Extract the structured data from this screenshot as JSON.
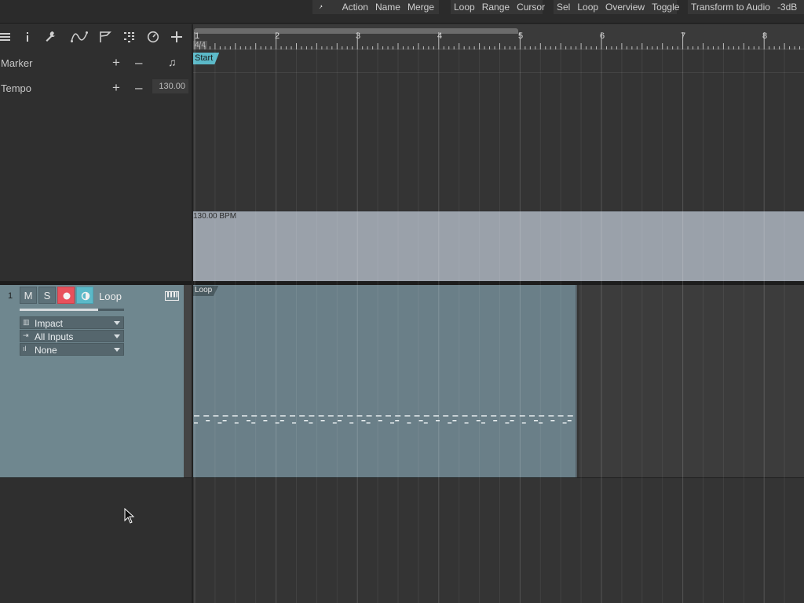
{
  "toolbar": {
    "group1": [
      "Action",
      "Name",
      "Merge"
    ],
    "group2": [
      "Loop",
      "Range",
      "Cursor"
    ],
    "group3": [
      "Sel",
      "Loop",
      "Overview",
      "Toggle"
    ],
    "group4": [
      "Transform to Audio",
      "-3dB",
      "+"
    ]
  },
  "header_icons": [
    "list-icon",
    "info-icon",
    "wrench-icon",
    "curve-icon",
    "flag-icon",
    "grid-icon",
    "clock-icon",
    "add-icon"
  ],
  "rows": {
    "marker": {
      "label": "Marker"
    },
    "tempo": {
      "label": "Tempo",
      "value": "130.00"
    }
  },
  "ruler": {
    "time_signature": "4/4",
    "bars": [
      "1",
      "2",
      "3",
      "4",
      "5",
      "6",
      "7",
      "8"
    ]
  },
  "start_marker": "Start",
  "tempo_lane_label": "130.00 BPM",
  "track": {
    "number": "1",
    "mute": "M",
    "solo": "S",
    "name": "Loop",
    "volume_level": 0.75,
    "instrument": "Impact",
    "input": "All Inputs",
    "output": "None"
  },
  "clip": {
    "name": "Loop"
  },
  "colors": {
    "start_marker": "#5bb9c8",
    "record_button": "#e8515c",
    "monitor_button": "#5bb9c8",
    "track_header": "#6f878f",
    "clip": "#6a7f88",
    "tempo_lane": "#9aa1aa"
  }
}
